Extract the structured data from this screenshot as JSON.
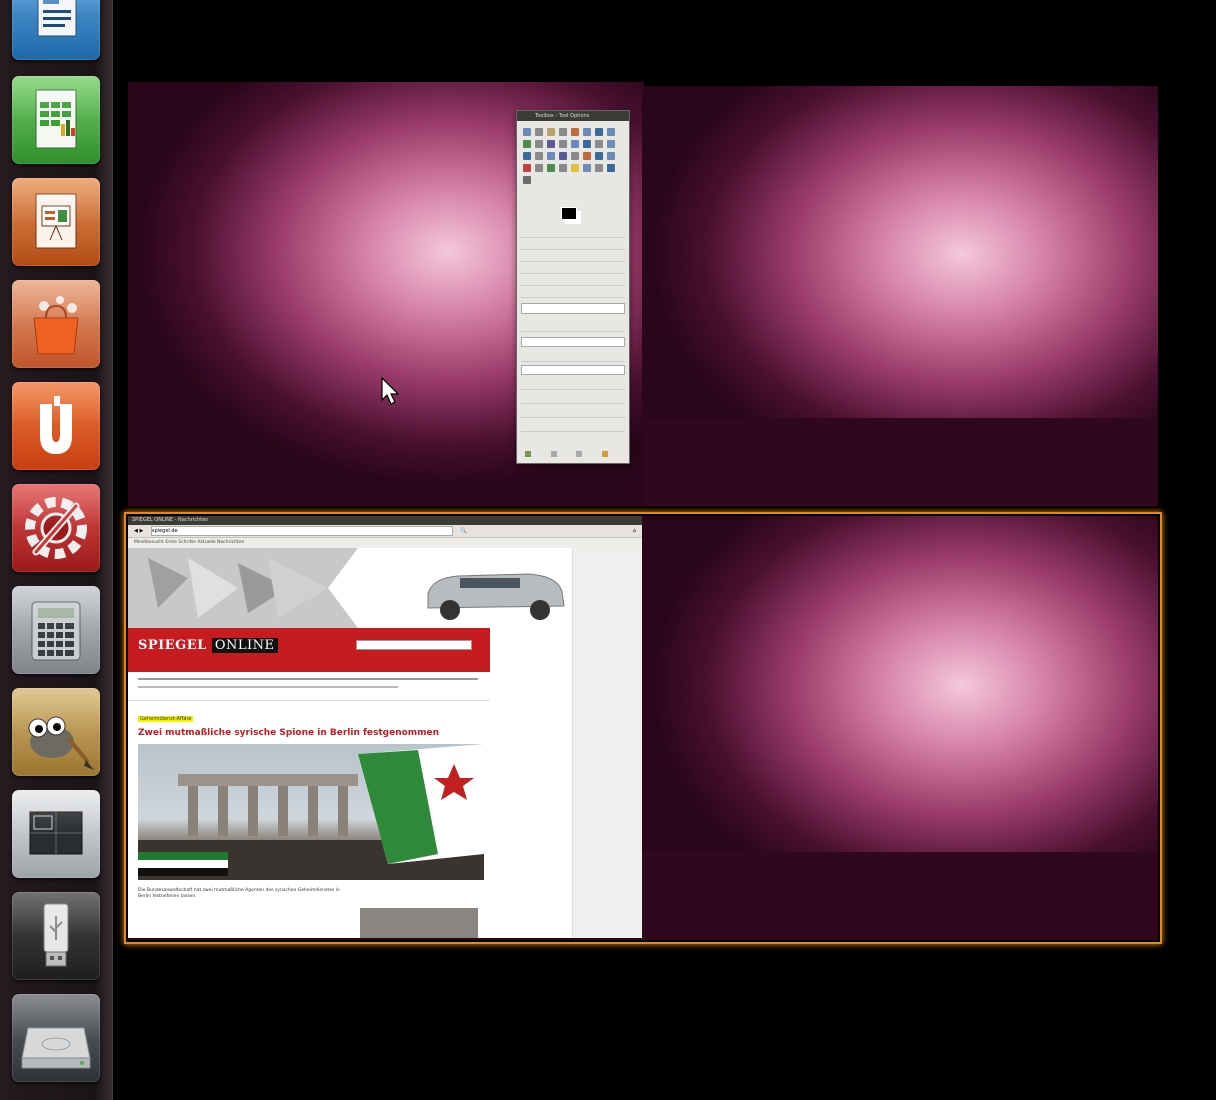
{
  "launcher": {
    "items": [
      {
        "name": "LibreOffice Writer",
        "icon": "writer-icon",
        "color": "#1d6aa9"
      },
      {
        "name": "LibreOffice Calc",
        "icon": "calc-icon",
        "color": "#3aa035"
      },
      {
        "name": "LibreOffice Impress",
        "icon": "impress-icon",
        "color": "#c2571a"
      },
      {
        "name": "Ubuntu Software Center",
        "icon": "software-center-icon",
        "color": "#e0541c"
      },
      {
        "name": "Ubuntu One",
        "icon": "ubuntu-one-icon",
        "color": "#e05421"
      },
      {
        "name": "System Settings",
        "icon": "system-settings-icon",
        "color": "#c62a2a"
      },
      {
        "name": "Calculator",
        "icon": "calculator-icon",
        "color": "#8d9296"
      },
      {
        "name": "GIMP",
        "icon": "gimp-icon",
        "color": "#b08a42"
      },
      {
        "name": "Workspace Switcher",
        "icon": "workspace-switcher-icon",
        "color": "#9ea3a8"
      },
      {
        "name": "USB Drive",
        "icon": "usb-drive-icon",
        "color": "#3c3c3c"
      },
      {
        "name": "Hard Drive",
        "icon": "hard-drive-icon",
        "color": "#aeb1b4"
      }
    ]
  },
  "workspaces": {
    "selected_index": 2,
    "accent": "#e08a1c"
  },
  "gimp": {
    "title": "Toolbox - Tool Options"
  },
  "browser": {
    "tab_title": "SPIEGEL ONLINE - Nachrichten",
    "url": "spiegel.de",
    "bookmarks": "Meistbesucht  Erste Schritte  Aktuelle Nachrichten",
    "logo_spiegel": "SPIEGEL",
    "logo_online": "ONLINE",
    "kicker": "Geheimdienst-Affäre",
    "headline": "Zwei mutmaßliche syrische Spione in Berlin festgenommen",
    "teaser": "Die Bundesanwaltschaft hat zwei mutmaßliche Agenten des syrischen Geheimdienstes in Berlin festnehmen lassen."
  }
}
